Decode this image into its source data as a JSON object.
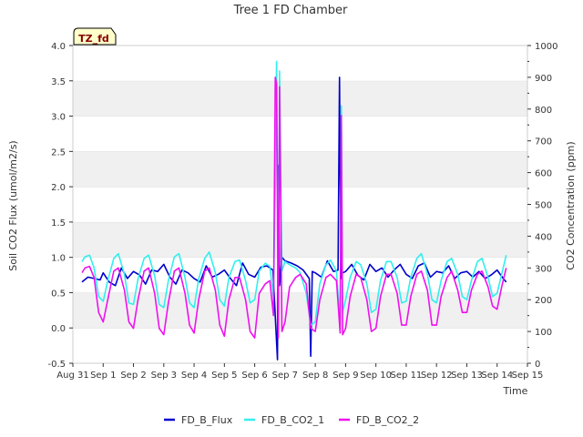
{
  "chart_data": {
    "type": "line",
    "title": "Tree 1 FD Chamber",
    "xlabel": "Time",
    "ylabel_left": "Soil CO2 Flux (umol/m2/s)",
    "ylabel_right": "CO2 Concentration (ppm)",
    "badge": "TZ_fd",
    "xlim": [
      0,
      15
    ],
    "x_ticks": [
      0,
      1,
      2,
      3,
      4,
      5,
      6,
      7,
      8,
      9,
      10,
      11,
      12,
      13,
      14,
      15
    ],
    "x_tick_labels": [
      "Aug 31",
      "Sep 1",
      "Sep 2",
      "Sep 3",
      "Sep 4",
      "Sep 5",
      "Sep 6",
      "Sep 7",
      "Sep 8",
      "Sep 9",
      "Sep 10",
      "Sep 11",
      "Sep 12",
      "Sep 13",
      "Sep 14",
      "Sep 15"
    ],
    "ylim_left": [
      -0.5,
      4.0
    ],
    "y_ticks_left": [
      "-0.5",
      "0.0",
      "0.5",
      "1.0",
      "1.5",
      "2.0",
      "2.5",
      "3.0",
      "3.5",
      "4.0"
    ],
    "ylim_right": [
      0,
      1000
    ],
    "y_ticks_right": [
      "0",
      "100",
      "200",
      "300",
      "400",
      "500",
      "600",
      "700",
      "800",
      "900",
      "1000"
    ],
    "legend_position": "bottom",
    "series": [
      {
        "name": "FD_B_Flux",
        "axis": "left",
        "color": "#0000cc",
        "x": [
          0.3,
          0.5,
          0.7,
          0.9,
          1.0,
          1.2,
          1.4,
          1.6,
          1.8,
          2.0,
          2.2,
          2.4,
          2.6,
          2.8,
          3.0,
          3.2,
          3.4,
          3.6,
          3.8,
          4.0,
          4.2,
          4.4,
          4.6,
          4.8,
          5.0,
          5.2,
          5.4,
          5.6,
          5.8,
          6.0,
          6.2,
          6.4,
          6.6,
          6.75,
          6.78,
          6.82,
          6.9,
          7.0,
          7.2,
          7.4,
          7.6,
          7.8,
          7.85,
          7.9,
          8.0,
          8.2,
          8.4,
          8.6,
          8.75,
          8.8,
          8.85,
          8.9,
          9.0,
          9.2,
          9.4,
          9.6,
          9.8,
          10.0,
          10.2,
          10.4,
          10.6,
          10.8,
          11.0,
          11.2,
          11.4,
          11.6,
          11.8,
          12.0,
          12.2,
          12.4,
          12.6,
          12.8,
          13.0,
          13.2,
          13.4,
          13.6,
          13.8,
          14.0,
          14.2,
          14.3
        ],
        "y": [
          0.65,
          0.72,
          0.7,
          0.68,
          0.78,
          0.65,
          0.6,
          0.85,
          0.7,
          0.8,
          0.75,
          0.62,
          0.82,
          0.8,
          0.9,
          0.72,
          0.62,
          0.82,
          0.78,
          0.7,
          0.65,
          0.88,
          0.72,
          0.76,
          0.82,
          0.7,
          0.6,
          0.92,
          0.76,
          0.72,
          0.86,
          0.88,
          0.82,
          -0.45,
          2.3,
          0.6,
          1.0,
          0.95,
          0.92,
          0.88,
          0.82,
          0.7,
          -0.4,
          0.8,
          0.78,
          0.72,
          0.95,
          0.8,
          0.82,
          3.55,
          0.7,
          0.78,
          0.8,
          0.9,
          0.75,
          0.68,
          0.9,
          0.8,
          0.85,
          0.72,
          0.82,
          0.9,
          0.76,
          0.7,
          0.88,
          0.92,
          0.72,
          0.8,
          0.78,
          0.88,
          0.7,
          0.78,
          0.8,
          0.72,
          0.8,
          0.7,
          0.75,
          0.82,
          0.7,
          0.65
        ]
      },
      {
        "name": "FD_B_CO2_1",
        "axis": "right",
        "color": "#33eeee",
        "x": [
          0.3,
          0.4,
          0.55,
          0.7,
          0.85,
          1.0,
          1.15,
          1.35,
          1.5,
          1.7,
          1.85,
          2.0,
          2.15,
          2.35,
          2.5,
          2.7,
          2.85,
          3.0,
          3.15,
          3.35,
          3.5,
          3.7,
          3.85,
          4.0,
          4.15,
          4.35,
          4.5,
          4.7,
          4.85,
          5.0,
          5.15,
          5.35,
          5.5,
          5.7,
          5.85,
          6.0,
          6.15,
          6.35,
          6.5,
          6.62,
          6.68,
          6.72,
          6.78,
          6.82,
          6.9,
          7.0,
          7.15,
          7.35,
          7.5,
          7.7,
          7.85,
          8.0,
          8.15,
          8.35,
          8.5,
          8.7,
          8.82,
          8.86,
          8.9,
          9.0,
          9.15,
          9.35,
          9.5,
          9.7,
          9.85,
          10.0,
          10.15,
          10.35,
          10.5,
          10.7,
          10.85,
          11.0,
          11.15,
          11.35,
          11.5,
          11.7,
          11.85,
          12.0,
          12.15,
          12.35,
          12.5,
          12.7,
          12.85,
          13.0,
          13.15,
          13.35,
          13.5,
          13.7,
          13.85,
          14.0,
          14.15,
          14.3
        ],
        "y": [
          320,
          335,
          340,
          300,
          210,
          195,
          260,
          330,
          345,
          280,
          190,
          185,
          265,
          330,
          340,
          275,
          185,
          175,
          260,
          335,
          345,
          270,
          190,
          175,
          265,
          330,
          350,
          285,
          200,
          180,
          270,
          320,
          325,
          260,
          190,
          200,
          290,
          315,
          305,
          210,
          560,
          950,
          150,
          920,
          290,
          320,
          310,
          300,
          285,
          220,
          120,
          130,
          250,
          310,
          325,
          290,
          120,
          810,
          160,
          200,
          270,
          320,
          310,
          250,
          160,
          170,
          260,
          320,
          320,
          270,
          190,
          195,
          270,
          330,
          345,
          280,
          200,
          190,
          260,
          320,
          330,
          280,
          210,
          200,
          260,
          320,
          330,
          270,
          210,
          220,
          280,
          340
        ]
      },
      {
        "name": "FD_B_CO2_2",
        "axis": "right",
        "color": "#ee11ee",
        "x": [
          0.3,
          0.4,
          0.55,
          0.7,
          0.85,
          1.0,
          1.15,
          1.35,
          1.5,
          1.7,
          1.85,
          2.0,
          2.15,
          2.35,
          2.5,
          2.7,
          2.85,
          3.0,
          3.15,
          3.35,
          3.5,
          3.7,
          3.85,
          4.0,
          4.15,
          4.35,
          4.5,
          4.7,
          4.85,
          5.0,
          5.15,
          5.35,
          5.5,
          5.7,
          5.85,
          6.0,
          6.15,
          6.35,
          6.5,
          6.62,
          6.68,
          6.72,
          6.78,
          6.82,
          6.9,
          7.0,
          7.15,
          7.35,
          7.5,
          7.7,
          7.85,
          8.0,
          8.15,
          8.35,
          8.5,
          8.7,
          8.82,
          8.86,
          8.9,
          9.0,
          9.15,
          9.35,
          9.5,
          9.7,
          9.85,
          10.0,
          10.15,
          10.35,
          10.5,
          10.7,
          10.85,
          11.0,
          11.15,
          11.35,
          11.5,
          11.7,
          11.85,
          12.0,
          12.15,
          12.35,
          12.5,
          12.7,
          12.85,
          13.0,
          13.15,
          13.35,
          13.5,
          13.7,
          13.85,
          14.0,
          14.15,
          14.3
        ],
        "y": [
          285,
          300,
          305,
          270,
          160,
          130,
          200,
          290,
          300,
          230,
          130,
          110,
          200,
          290,
          300,
          220,
          110,
          90,
          190,
          290,
          300,
          220,
          120,
          95,
          200,
          290,
          300,
          230,
          120,
          85,
          200,
          270,
          270,
          200,
          100,
          80,
          220,
          250,
          260,
          150,
          900,
          880,
          80,
          870,
          100,
          130,
          240,
          270,
          280,
          250,
          110,
          100,
          200,
          270,
          280,
          260,
          95,
          780,
          90,
          110,
          210,
          280,
          270,
          200,
          100,
          110,
          210,
          280,
          280,
          220,
          120,
          120,
          210,
          280,
          290,
          230,
          120,
          120,
          210,
          270,
          290,
          230,
          160,
          160,
          230,
          280,
          290,
          240,
          180,
          170,
          240,
          300
        ]
      }
    ]
  }
}
